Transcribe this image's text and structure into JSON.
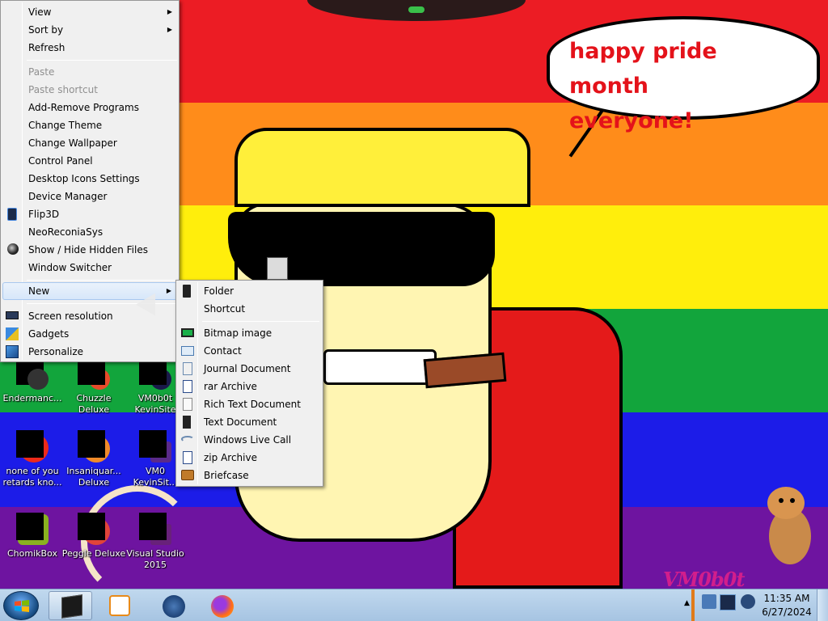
{
  "speech_bubble": {
    "line1": "happy pride month",
    "line2": "everyone!"
  },
  "watermark": "VM0b0t",
  "desktop_icons": [
    {
      "label_1": "Endermanc...",
      "label_2": ""
    },
    {
      "label_1": "Chuzzle",
      "label_2": "Deluxe"
    },
    {
      "label_1": "VM0b0t",
      "label_2": "KevinSite"
    },
    {
      "label_1": "none of you",
      "label_2": "retards kno..."
    },
    {
      "label_1": "Insaniquar...",
      "label_2": "Deluxe"
    },
    {
      "label_1": "VM0",
      "label_2": "KevinSit..."
    },
    {
      "label_1": "ChomikBox",
      "label_2": ""
    },
    {
      "label_1": "Peggle Deluxe",
      "label_2": ""
    },
    {
      "label_1": "Visual Studio",
      "label_2": "2015"
    }
  ],
  "context_menu": {
    "items": [
      {
        "label": "View",
        "submenu": true,
        "disabled": false
      },
      {
        "label": "Sort by",
        "submenu": true,
        "disabled": false
      },
      {
        "label": "Refresh",
        "submenu": false,
        "disabled": false
      },
      {
        "label": "Paste",
        "submenu": false,
        "disabled": true
      },
      {
        "label": "Paste shortcut",
        "submenu": false,
        "disabled": true
      },
      {
        "label": "Add-Remove Programs",
        "submenu": false,
        "disabled": false
      },
      {
        "label": "Change Theme",
        "submenu": false,
        "disabled": false
      },
      {
        "label": "Change Wallpaper",
        "submenu": false,
        "disabled": false
      },
      {
        "label": "Control Panel",
        "submenu": false,
        "disabled": false
      },
      {
        "label": "Desktop Icons Settings",
        "submenu": false,
        "disabled": false
      },
      {
        "label": "Device Manager",
        "submenu": false,
        "disabled": false
      },
      {
        "label": "Flip3D",
        "submenu": false,
        "disabled": false,
        "icon": "flip3d-icon"
      },
      {
        "label": "NeoReconiaSys",
        "submenu": false,
        "disabled": false
      },
      {
        "label": "Show / Hide Hidden Files",
        "submenu": false,
        "disabled": false,
        "icon": "hidden-files-icon"
      },
      {
        "label": "Window Switcher",
        "submenu": false,
        "disabled": false
      },
      {
        "label": "New",
        "submenu": true,
        "disabled": false,
        "highlighted": true
      },
      {
        "label": "Screen resolution",
        "submenu": false,
        "disabled": false,
        "icon": "monitor-icon"
      },
      {
        "label": "Gadgets",
        "submenu": false,
        "disabled": false,
        "icon": "gadgets-icon"
      },
      {
        "label": "Personalize",
        "submenu": false,
        "disabled": false,
        "icon": "personalize-icon"
      }
    ]
  },
  "new_submenu": {
    "items": [
      {
        "label": "Folder",
        "icon": "folder-icon"
      },
      {
        "label": "Shortcut",
        "icon": ""
      },
      {
        "label": "Bitmap image",
        "icon": "bitmap-icon"
      },
      {
        "label": "Contact",
        "icon": "contact-icon"
      },
      {
        "label": "Journal Document",
        "icon": "journal-icon"
      },
      {
        "label": "rar Archive",
        "icon": "rar-icon"
      },
      {
        "label": "Rich Text Document",
        "icon": "rtf-icon"
      },
      {
        "label": "Text Document",
        "icon": "text-doc-icon"
      },
      {
        "label": "Windows Live Call",
        "icon": "live-call-icon"
      },
      {
        "label": "zip Archive",
        "icon": "zip-icon"
      },
      {
        "label": "Briefcase",
        "icon": "briefcase-icon"
      }
    ]
  },
  "taskbar": {
    "buttons": [
      "blackbox-icon",
      "media-player-icon",
      "steam-icon",
      "firefox-icon"
    ],
    "tray_icons": [
      "action-center-icon",
      "network-icon",
      "volume-icon"
    ],
    "clock": {
      "time": "11:35 AM",
      "date": "6/27/2024"
    }
  },
  "colors": {
    "rainbow": [
      "#ec1c24",
      "#ff8c1a",
      "#ffee0c",
      "#12a53c",
      "#1c1ce8",
      "#6e14a0"
    ],
    "speech_text": "#e4121a",
    "watermark": "#d21e8c"
  }
}
